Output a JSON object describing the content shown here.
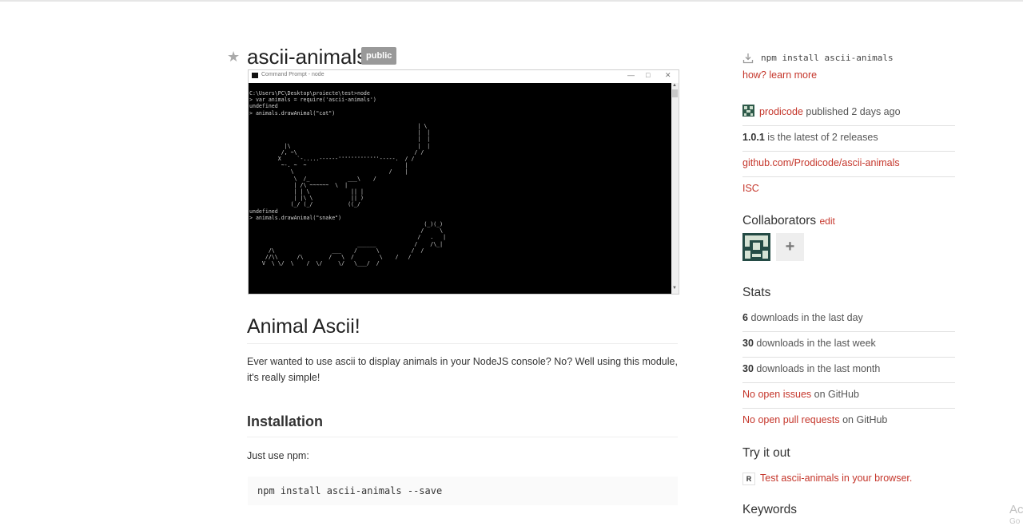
{
  "package": {
    "name": "ascii-animals",
    "badge": "public"
  },
  "console": {
    "title": "Command Prompt - node",
    "output": "C:\\Users\\PC\\Desktop\\proiecte\\test>node\n> var animals = require('ascii-animals')\nundefined\n> animals.drawAnimal(\"cat\")\n\n                                                     | \\\n                                                     |  |\n                                                     |  |\n           |\\                                        |  |\n          /, ~\\                                     / /\n         X     `-.....------'''''''''''''-----.  / /\n          ~-. ~  ~                               |\n             \\                              /    |\n              \\  /_            ___\\    /\n              | /\\ ~~~~~~  \\  |\n              | | \\             || |\n              | |\\ \\            || )\n             (_/ (_/           ((_/\nundefined\n> animals.drawAnimal(\"snake\")\n                                                       (_)(_)\n                                                      /     \\\n                                                     /   .   |\n                                  ______            /    /\\_|\n      /\\                  ___    /      \\          /  /\n     //\\\\      /\\        /   \\  /        \\    /   /\n    V  \\ \\/  \\    /  \\/     \\/   \\___/  /"
  },
  "readme": {
    "heading": "Animal Ascii!",
    "intro": "Ever wanted to use ascii to display animals in your NodeJS console? No? Well using this module, it's really simple!",
    "installation_heading": "Installation",
    "installation_text": "Just use npm:",
    "install_code": "npm install ascii-animals --save"
  },
  "sidebar": {
    "install_command": "npm install ascii-animals",
    "learn_link": "how? learn more",
    "publisher": "prodicode",
    "published_text": "published 2 days ago",
    "version": "1.0.1",
    "version_text": "is the latest of 2 releases",
    "repo_link": "github.com/Prodicode/ascii-animals",
    "license": "ISC",
    "collaborators_title": "Collaborators",
    "collaborators_edit": "edit",
    "add_symbol": "+",
    "stats_title": "Stats",
    "stats": [
      {
        "count": "6",
        "label": "downloads in the last day"
      },
      {
        "count": "30",
        "label": "downloads in the last week"
      },
      {
        "count": "30",
        "label": "downloads in the last month"
      }
    ],
    "issues_link": "No open issues",
    "issues_suffix": "on GitHub",
    "prs_link": "No open pull requests",
    "prs_suffix": "on GitHub",
    "try_title": "Try it out",
    "try_icon": "R",
    "try_link": "Test ascii-animals in your browser.",
    "keywords_title": "Keywords"
  },
  "watermark": {
    "line1": "Ac",
    "line2": "Go"
  }
}
